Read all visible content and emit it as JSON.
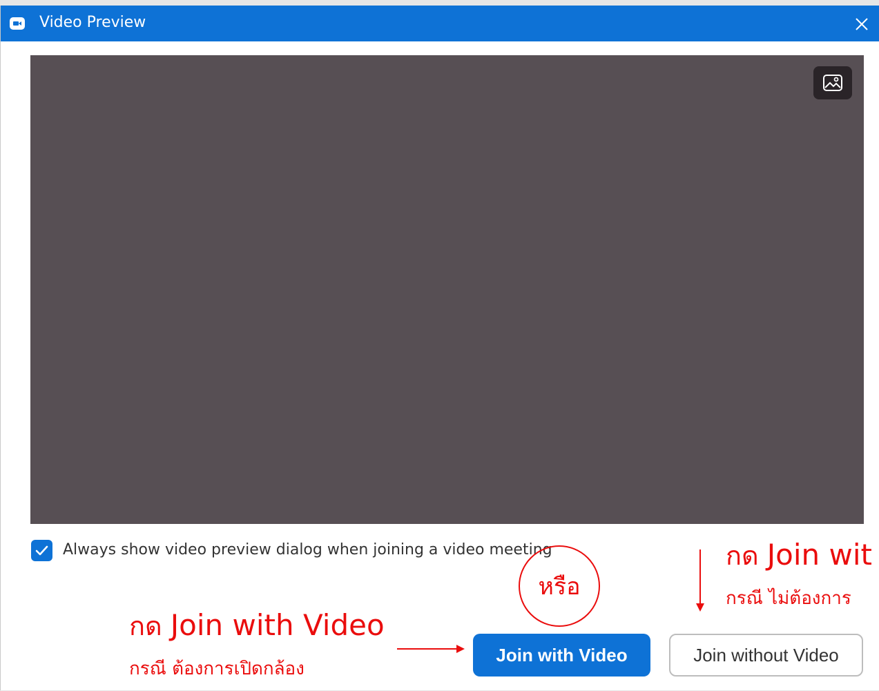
{
  "window": {
    "title": "Video Preview",
    "app_icon": "zoom-camera-icon",
    "close_icon": "close-icon"
  },
  "preview": {
    "background_button_icon": "background-image-icon"
  },
  "options": {
    "always_show_checked": true,
    "always_show_label": "Always show video preview dialog when joining a video meeting"
  },
  "buttons": {
    "join_with_video": "Join with Video",
    "join_without_video": "Join without Video"
  },
  "annotations": {
    "left_heading_prefix": "กด",
    "left_heading_emph": "Join with Video",
    "left_caption": "กรณี ต้องการเปิดกล้อง",
    "or_label": "หรือ",
    "right_heading_prefix": "กด",
    "right_heading_emph": "Join wit",
    "right_caption": "กรณี ไม่ต้องการ"
  },
  "colors": {
    "titlebar": "#0e72d6",
    "primary_button": "#0e72d6",
    "preview_bg": "#574f54",
    "annotation_red": "#ea0d0d"
  }
}
